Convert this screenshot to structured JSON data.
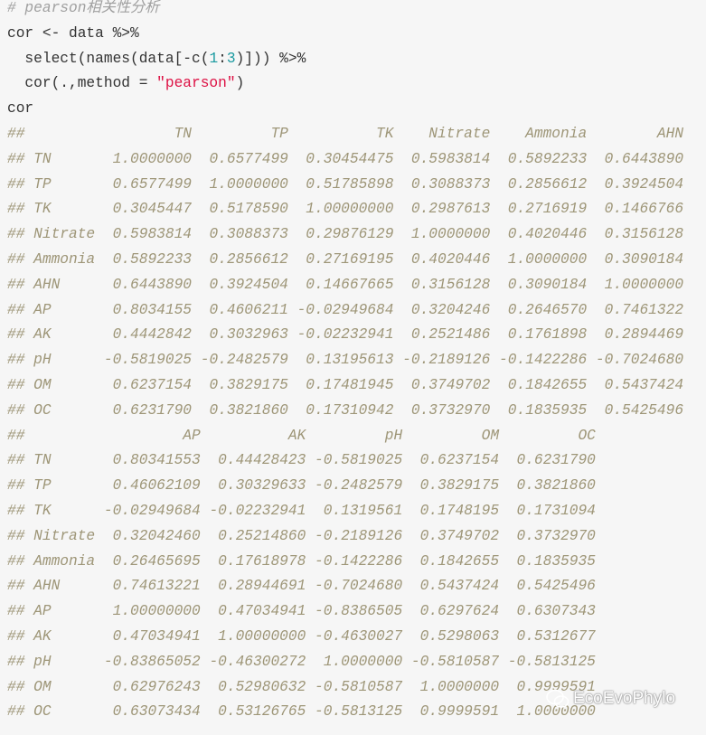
{
  "colors": {
    "code": "#333333",
    "comment": "#a0a0a0",
    "number": "#1a9aa0",
    "string": "#dd1144",
    "output": "#9e9678",
    "background": "#f6f6f6"
  },
  "code": [
    [
      {
        "t": "# pearson相关性分析",
        "k": "comment"
      }
    ],
    [
      {
        "t": "cor <- data %>%",
        "k": "code"
      }
    ],
    [
      {
        "t": "  select(names(data[-c(",
        "k": "code"
      },
      {
        "t": "1",
        "k": "num"
      },
      {
        "t": ":",
        "k": "code"
      },
      {
        "t": "3",
        "k": "num"
      },
      {
        "t": ")])) %>%",
        "k": "code"
      }
    ],
    [
      {
        "t": "  cor(.,method = ",
        "k": "code"
      },
      {
        "t": "\"pearson\"",
        "k": "str"
      },
      {
        "t": ")",
        "k": "code"
      }
    ],
    [
      {
        "t": "cor",
        "k": "code"
      }
    ]
  ],
  "output": {
    "prefix": "##",
    "blocks": [
      {
        "header": [
          "TN",
          "TP",
          "TK",
          "Nitrate",
          "Ammonia",
          "AHN"
        ],
        "rows": [
          {
            "name": "TN",
            "values": [
              "1.0000000",
              "0.6577499",
              "0.30454475",
              "0.5983814",
              "0.5892233",
              "0.6443890"
            ]
          },
          {
            "name": "TP",
            "values": [
              "0.6577499",
              "1.0000000",
              "0.51785898",
              "0.3088373",
              "0.2856612",
              "0.3924504"
            ]
          },
          {
            "name": "TK",
            "values": [
              "0.3045447",
              "0.5178590",
              "1.00000000",
              "0.2987613",
              "0.2716919",
              "0.1466766"
            ]
          },
          {
            "name": "Nitrate",
            "values": [
              "0.5983814",
              "0.3088373",
              "0.29876129",
              "1.0000000",
              "0.4020446",
              "0.3156128"
            ]
          },
          {
            "name": "Ammonia",
            "values": [
              "0.5892233",
              "0.2856612",
              "0.27169195",
              "0.4020446",
              "1.0000000",
              "0.3090184"
            ]
          },
          {
            "name": "AHN",
            "values": [
              "0.6443890",
              "0.3924504",
              "0.14667665",
              "0.3156128",
              "0.3090184",
              "1.0000000"
            ]
          },
          {
            "name": "AP",
            "values": [
              "0.8034155",
              "0.4606211",
              "-0.02949684",
              "0.3204246",
              "0.2646570",
              "0.7461322"
            ]
          },
          {
            "name": "AK",
            "values": [
              "0.4442842",
              "0.3032963",
              "-0.02232941",
              "0.2521486",
              "0.1761898",
              "0.2894469"
            ]
          },
          {
            "name": "pH",
            "values": [
              "-0.5819025",
              "-0.2482579",
              "0.13195613",
              "-0.2189126",
              "-0.1422286",
              "-0.7024680"
            ]
          },
          {
            "name": "OM",
            "values": [
              "0.6237154",
              "0.3829175",
              "0.17481945",
              "0.3749702",
              "0.1842655",
              "0.5437424"
            ]
          },
          {
            "name": "OC",
            "values": [
              "0.6231790",
              "0.3821860",
              "0.17310942",
              "0.3732970",
              "0.1835935",
              "0.5425496"
            ]
          }
        ]
      },
      {
        "header": [
          "AP",
          "AK",
          "pH",
          "OM",
          "OC"
        ],
        "rows": [
          {
            "name": "TN",
            "values": [
              "0.80341553",
              "0.44428423",
              "-0.5819025",
              "0.6237154",
              "0.6231790"
            ]
          },
          {
            "name": "TP",
            "values": [
              "0.46062109",
              "0.30329633",
              "-0.2482579",
              "0.3829175",
              "0.3821860"
            ]
          },
          {
            "name": "TK",
            "values": [
              "-0.02949684",
              "-0.02232941",
              "0.1319561",
              "0.1748195",
              "0.1731094"
            ]
          },
          {
            "name": "Nitrate",
            "values": [
              "0.32042460",
              "0.25214860",
              "-0.2189126",
              "0.3749702",
              "0.3732970"
            ]
          },
          {
            "name": "Ammonia",
            "values": [
              "0.26465695",
              "0.17618978",
              "-0.1422286",
              "0.1842655",
              "0.1835935"
            ]
          },
          {
            "name": "AHN",
            "values": [
              "0.74613221",
              "0.28944691",
              "-0.7024680",
              "0.5437424",
              "0.5425496"
            ]
          },
          {
            "name": "AP",
            "values": [
              "1.00000000",
              "0.47034941",
              "-0.8386505",
              "0.6297624",
              "0.6307343"
            ]
          },
          {
            "name": "AK",
            "values": [
              "0.47034941",
              "1.00000000",
              "-0.4630027",
              "0.5298063",
              "0.5312677"
            ]
          },
          {
            "name": "pH",
            "values": [
              "-0.83865052",
              "-0.46300272",
              "1.0000000",
              "-0.5810587",
              "-0.5813125"
            ]
          },
          {
            "name": "OM",
            "values": [
              "0.62976243",
              "0.52980632",
              "-0.5810587",
              "1.0000000",
              "0.9999591"
            ]
          },
          {
            "name": "OC",
            "values": [
              "0.63073434",
              "0.53126765",
              "-0.5813125",
              "0.9999591",
              "1.0000000"
            ]
          }
        ]
      }
    ]
  },
  "watermark": {
    "text": "EcoEvoPhylo",
    "icon": "wechat-icon"
  }
}
